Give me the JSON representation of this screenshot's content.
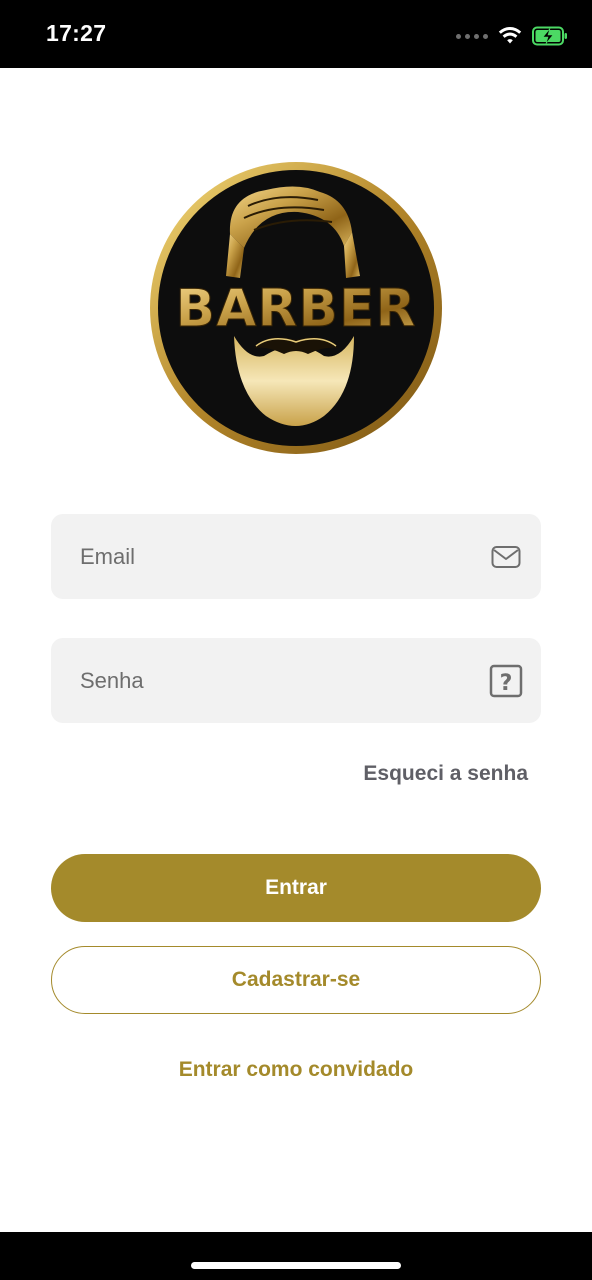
{
  "status_bar": {
    "time": "17:27",
    "icons": [
      "signal-icon",
      "wifi-icon",
      "battery-charging-icon"
    ]
  },
  "logo": {
    "text": "BARBER",
    "icon": "barber-logo"
  },
  "login_form": {
    "email_placeholder": "Email",
    "email_value": "",
    "email_icon": "mail-icon",
    "password_placeholder": "Senha",
    "password_value": "",
    "password_icon": "help-box-icon",
    "forgot_password_label": "Esqueci a senha"
  },
  "actions": {
    "login_label": "Entrar",
    "register_label": "Cadastrar-se",
    "guest_label": "Entrar como convidado"
  },
  "colors": {
    "accent": "#a48a2b",
    "field_background": "#f2f2f2",
    "status_bar_background": "#000000"
  }
}
